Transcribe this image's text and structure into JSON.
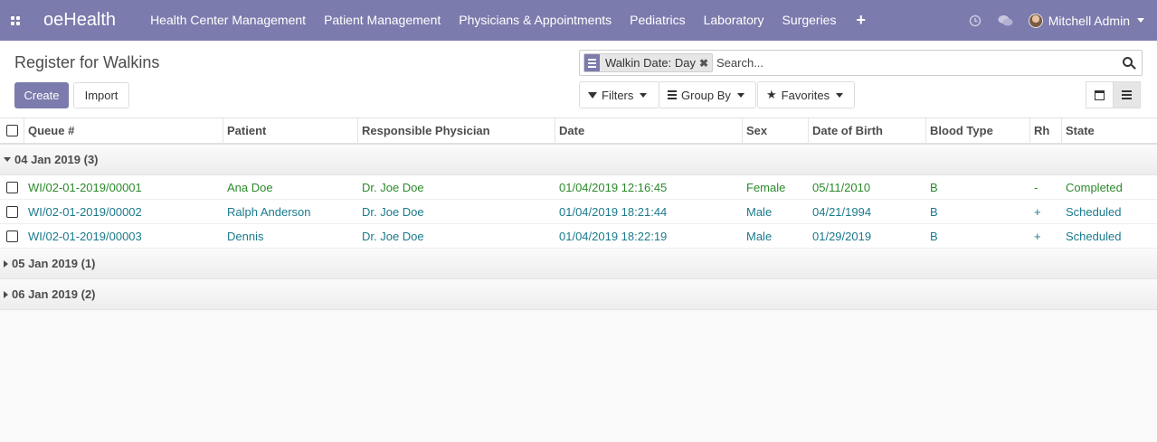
{
  "navbar": {
    "brand": "oeHealth",
    "menu": [
      "Health Center Management",
      "Patient Management",
      "Physicians & Appointments",
      "Pediatrics",
      "Laboratory",
      "Surgeries"
    ],
    "user": "Mitchell Admin"
  },
  "control_panel": {
    "breadcrumb": "Register for Walkins",
    "create_label": "Create",
    "import_label": "Import",
    "search": {
      "facet": "Walkin Date: Day",
      "placeholder": "Search..."
    },
    "filters_label": "Filters",
    "groupby_label": "Group By",
    "favorites_label": "Favorites"
  },
  "table": {
    "columns": [
      "Queue #",
      "Patient",
      "Responsible Physician",
      "Date",
      "Sex",
      "Date of Birth",
      "Blood Type",
      "Rh",
      "State"
    ],
    "groups": [
      {
        "label": "04 Jan 2019 (3)",
        "expanded": true,
        "rows": [
          {
            "queue": "WI/02-01-2019/00001",
            "patient": "Ana Doe",
            "physician": "Dr. Joe Doe",
            "date": "01/04/2019 12:16:45",
            "sex": "Female",
            "dob": "05/11/2010",
            "blood": "B",
            "rh": "-",
            "state": "Completed"
          },
          {
            "queue": "WI/02-01-2019/00002",
            "patient": "Ralph Anderson",
            "physician": "Dr. Joe Doe",
            "date": "01/04/2019 18:21:44",
            "sex": "Male",
            "dob": "04/21/1994",
            "blood": "B",
            "rh": "+",
            "state": "Scheduled"
          },
          {
            "queue": "WI/02-01-2019/00003",
            "patient": "Dennis",
            "physician": "Dr. Joe Doe",
            "date": "01/04/2019 18:22:19",
            "sex": "Male",
            "dob": "01/29/2019",
            "blood": "B",
            "rh": "+",
            "state": "Scheduled"
          }
        ]
      },
      {
        "label": "05 Jan 2019 (1)",
        "expanded": false
      },
      {
        "label": "06 Jan 2019 (2)",
        "expanded": false
      }
    ]
  },
  "colors": {
    "brand": "#7c7bad",
    "completed": "#2b8a2b",
    "scheduled": "#1b7a8c"
  }
}
